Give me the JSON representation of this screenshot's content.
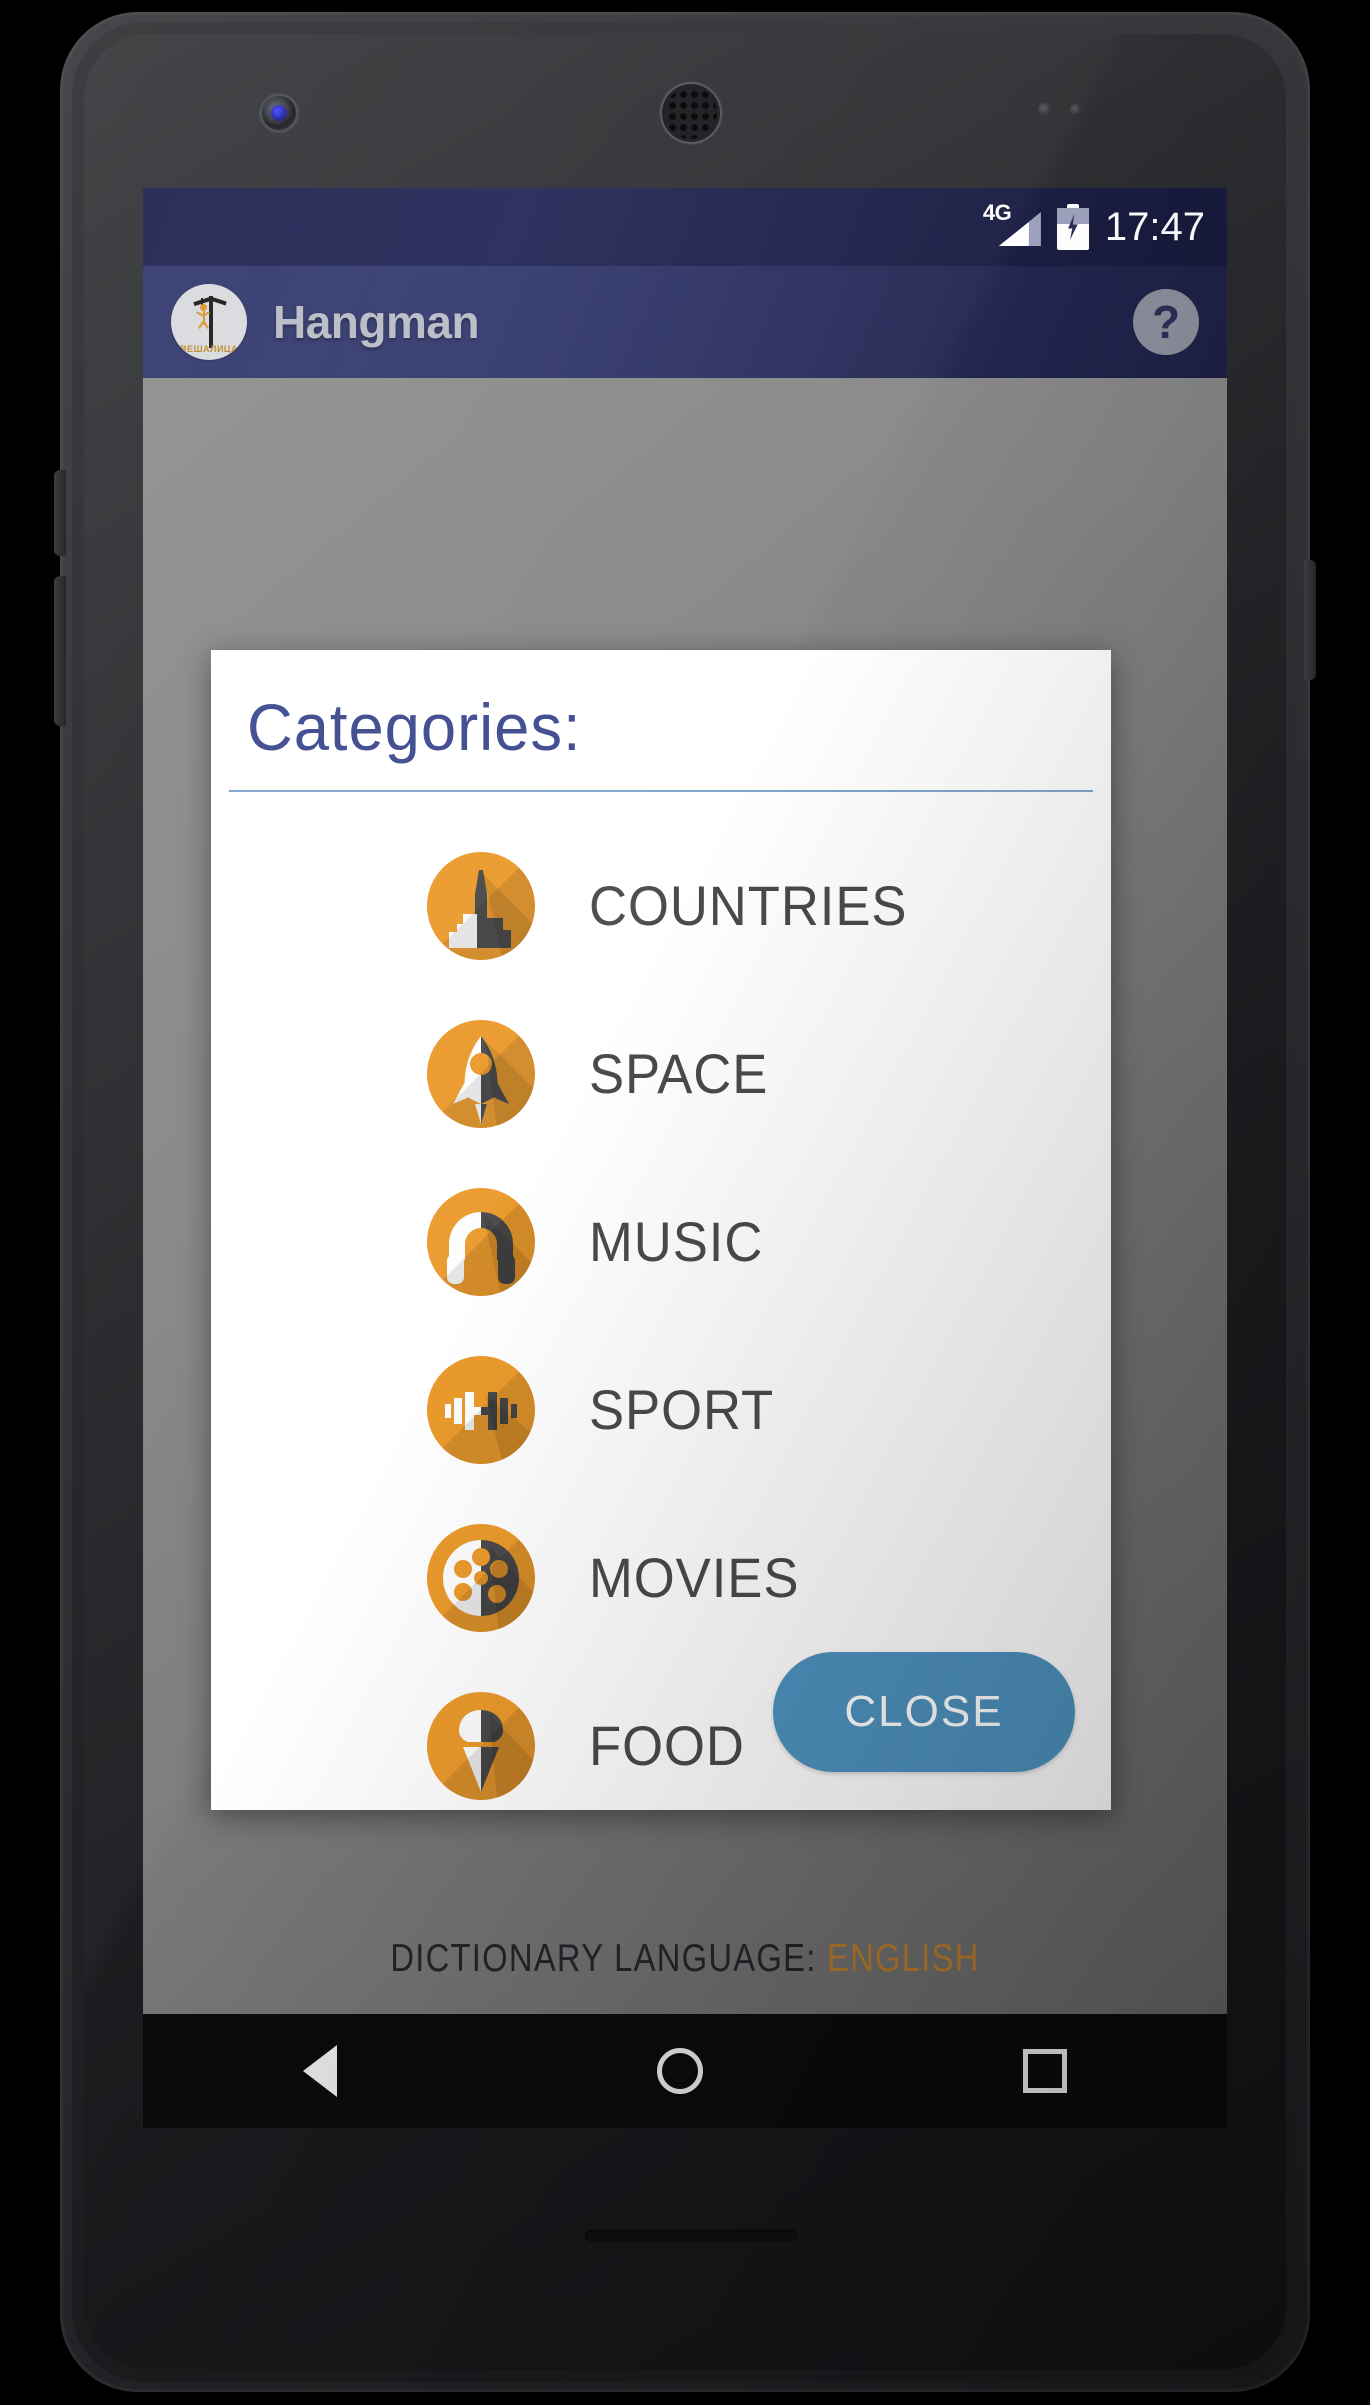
{
  "statusbar": {
    "network_label": "4G",
    "time": "17:47",
    "signal_icon": "signal-bars-icon",
    "battery_icon": "battery-charging-icon"
  },
  "appbar": {
    "title": "Hangman",
    "logo_brand": "ВЕШАЛИЦА",
    "logo_icon": "hangman-gallows-icon",
    "help_label": "?"
  },
  "dialog": {
    "title": "Categories:",
    "categories": [
      {
        "label": "COUNTRIES",
        "icon": "skyscraper-icon"
      },
      {
        "label": "SPACE",
        "icon": "rocket-icon"
      },
      {
        "label": "MUSIC",
        "icon": "headphones-icon"
      },
      {
        "label": "SPORT",
        "icon": "dumbbell-icon"
      },
      {
        "label": "MOVIES",
        "icon": "film-reel-icon"
      },
      {
        "label": "FOOD",
        "icon": "ice-cream-cone-icon"
      }
    ],
    "close_label": "CLOSE"
  },
  "page": {
    "dictionary_prefix": "DICTIONARY LANGUAGE:",
    "dictionary_language": "ENGLISH"
  },
  "navbar": {
    "back": "back-triangle-icon",
    "home": "home-circle-icon",
    "recents": "recents-square-icon"
  },
  "colors": {
    "accent_orange": "#ea9a2c",
    "dialog_title_blue": "#3e4a8e",
    "close_button_blue": "#4e92bf",
    "appbar_indigo": "#2b3060",
    "language_amber": "#b4792c"
  }
}
